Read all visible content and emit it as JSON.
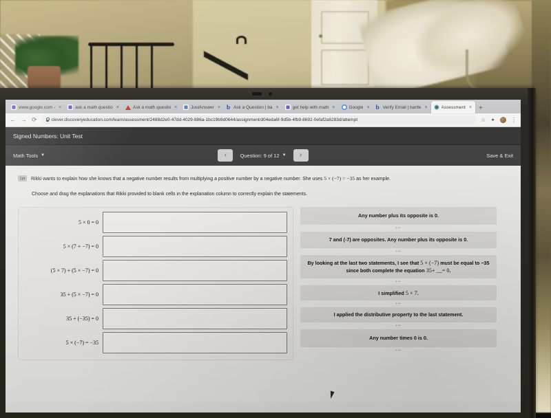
{
  "browser": {
    "tabs": [
      {
        "title": "www.google.com -",
        "favicon": "purple-square-icon",
        "active": false
      },
      {
        "title": "ask a math questio",
        "favicon": "purple-square-icon",
        "active": false
      },
      {
        "title": "Ask a math questio",
        "favicon": "red-triangle-icon",
        "active": false
      },
      {
        "title": "JustAnswer",
        "favicon": "justanswer-icon",
        "active": false
      },
      {
        "title": "Ask a Question | ba",
        "favicon": "bartleby-icon",
        "active": false
      },
      {
        "title": "get help with math",
        "favicon": "purple-square-icon",
        "active": false
      },
      {
        "title": "Google",
        "favicon": "google-icon",
        "active": false
      },
      {
        "title": "Verify Email | bartle",
        "favicon": "bartleby-icon",
        "active": false
      },
      {
        "title": "Assessment",
        "favicon": "assessment-icon",
        "active": true
      }
    ],
    "new_tab_label": "+",
    "close_label": "×",
    "back_label": "←",
    "forward_label": "→",
    "reload_label": "⟳",
    "url": "clever.discoveryeducation.com/learn/assessment/2488d2e0-47dd-4029-886a-1bc19b9d0644/assignment/d04eda6f-9d5b-4fb9-8692-0efaf2a6283d/attempt",
    "star_label": "☆",
    "extensions_label": "✦",
    "menu_label": "⋮"
  },
  "app": {
    "title": "Signed Numbers: Unit Test",
    "math_tools_label": "Math Tools",
    "caret": "▼",
    "prev_label": "‹",
    "next_label": "›",
    "question_label": "Question: 9 of 12",
    "save_exit_label": "Save & Exit"
  },
  "question": {
    "points_badge": "1pt",
    "prompt_part1": "Rikki wants to explain how she knows that a negative number results from multiplying a positive number by a negative number.  She uses ",
    "prompt_math": "5 × (−7) = −35",
    "prompt_part2": " as her example.",
    "instruction": "Choose and drag the explanations that Rikki provided to blank cells in the explanation column to correctly explain the statements.",
    "rows": [
      {
        "equation": "5 × 0 = 0",
        "answer": ""
      },
      {
        "equation": "5 × (7 + −7) = 0",
        "answer": ""
      },
      {
        "equation": "(5 × 7) + (5 × −7) = 0",
        "answer": ""
      },
      {
        "equation": "35 + (5 × −7) = 0",
        "answer": ""
      },
      {
        "equation": "35 + (−35) = 0",
        "answer": ""
      },
      {
        "equation": "5 × (−7) = −35",
        "answer": ""
      }
    ],
    "drag_handle": "•••",
    "explanations": [
      {
        "text": "Any number plus its opposite is 0."
      },
      {
        "text": "7 and (-7) are opposites.  Any number plus its opposite is 0."
      },
      {
        "text_a": "By looking at the last two statements, I see that ",
        "math_a": "5 × (−7)",
        "text_b": " must be equal to −35 since both complete the equation ",
        "math_b": "35+ __= 0",
        "text_c": "."
      },
      {
        "text_a": "I simplified ",
        "math_a": "5 × 7",
        "text_c": "."
      },
      {
        "text": "I applied the distributive property to the last statement."
      },
      {
        "text": "Any number times 0 is 0."
      }
    ]
  },
  "colors": {
    "app_title_bar": "#2e2e2e",
    "app_toolbar": "#3b3b3b",
    "body_bg": "#eeeeec",
    "card_bg": "#dddcd9",
    "dropbox_bg": "#f3f2ef"
  }
}
